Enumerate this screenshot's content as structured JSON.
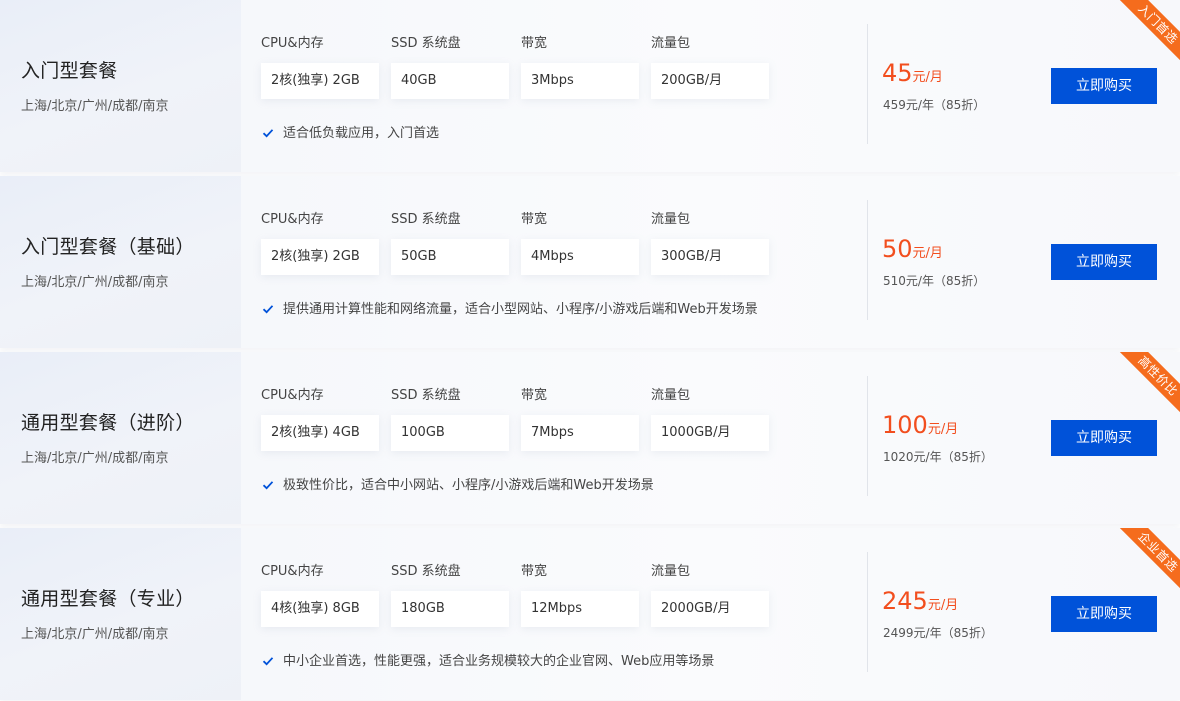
{
  "spec_labels": {
    "cpu": "CPU&内存",
    "ssd": "SSD 系统盘",
    "bw": "带宽",
    "traffic": "流量包"
  },
  "buy_label": "立即购买",
  "plans": [
    {
      "name": "入门型套餐",
      "cities": "上海/北京/广州/成都/南京",
      "cpu": "2核(独享) 2GB",
      "ssd": "40GB",
      "bw": "3Mbps",
      "traffic": "200GB/月",
      "feature": "适合低负载应用，入门首选",
      "price": "45",
      "unit": "元/月",
      "year": "459元/年（85折）",
      "ribbon": "入门首选"
    },
    {
      "name": "入门型套餐（基础）",
      "cities": "上海/北京/广州/成都/南京",
      "cpu": "2核(独享) 2GB",
      "ssd": "50GB",
      "bw": "4Mbps",
      "traffic": "300GB/月",
      "feature": "提供通用计算性能和网络流量，适合小型网站、小程序/小游戏后端和Web开发场景",
      "price": "50",
      "unit": "元/月",
      "year": "510元/年（85折）",
      "ribbon": ""
    },
    {
      "name": "通用型套餐（进阶）",
      "cities": "上海/北京/广州/成都/南京",
      "cpu": "2核(独享) 4GB",
      "ssd": "100GB",
      "bw": "7Mbps",
      "traffic": "1000GB/月",
      "feature": "极致性价比，适合中小网站、小程序/小游戏后端和Web开发场景",
      "price": "100",
      "unit": "元/月",
      "year": "1020元/年（85折）",
      "ribbon": "高性价比"
    },
    {
      "name": "通用型套餐（专业）",
      "cities": "上海/北京/广州/成都/南京",
      "cpu": "4核(独享) 8GB",
      "ssd": "180GB",
      "bw": "12Mbps",
      "traffic": "2000GB/月",
      "feature": "中小企业首选，性能更强，适合业务规模较大的企业官网、Web应用等场景",
      "price": "245",
      "unit": "元/月",
      "year": "2499元/年（85折）",
      "ribbon": "企业首选"
    }
  ],
  "colors": {
    "accent": "#0052d9",
    "price": "#f24e1e",
    "ribbon": "#f56c1d",
    "check": "#0052d9"
  },
  "icons": {
    "feature": "check-icon"
  }
}
